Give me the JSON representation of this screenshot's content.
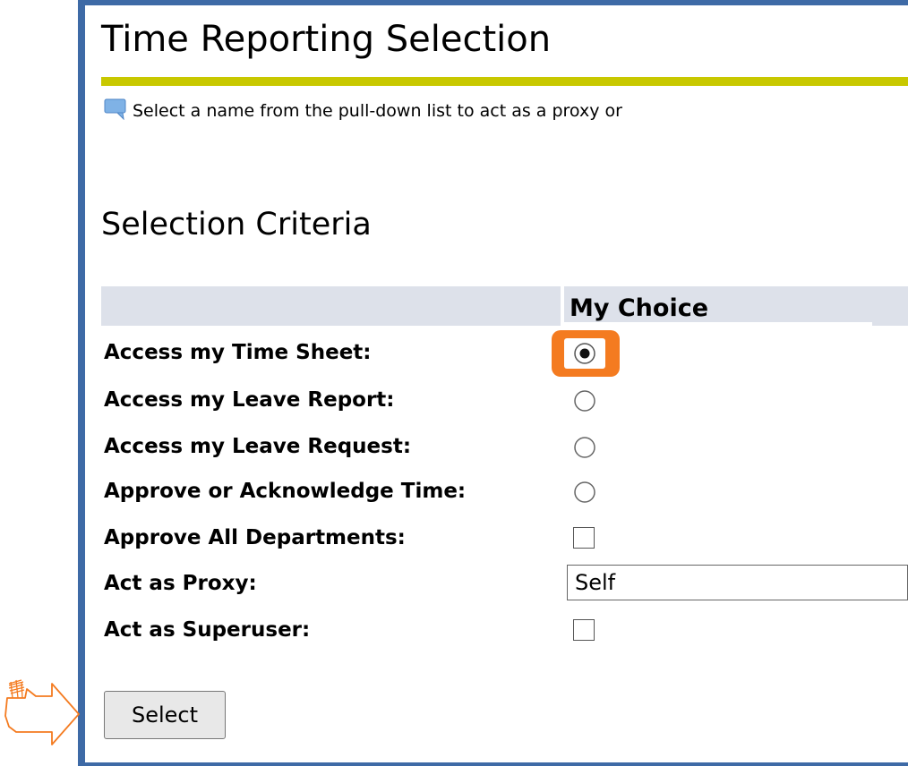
{
  "page": {
    "title": "Time Reporting Selection",
    "info_text": "Select a name from the pull-down list to act as a proxy or",
    "section_title": "Selection Criteria"
  },
  "table": {
    "column_header": "My Choice",
    "rows": [
      {
        "label": "Access my Time Sheet:",
        "control": "radio",
        "checked": true
      },
      {
        "label": "Access my Leave Report:",
        "control": "radio",
        "checked": false
      },
      {
        "label": "Access my Leave Request:",
        "control": "radio",
        "checked": false
      },
      {
        "label": "Approve or Acknowledge Time:",
        "control": "radio",
        "checked": false
      },
      {
        "label": "Approve All Departments:",
        "control": "checkbox",
        "checked": false
      },
      {
        "label": "Act as Proxy:",
        "control": "select",
        "value": "Self"
      },
      {
        "label": "Act as Superuser:",
        "control": "checkbox",
        "checked": false
      }
    ]
  },
  "actions": {
    "select_label": "Select"
  },
  "colors": {
    "frame": "#3e6aa6",
    "title_rule": "#c8c800",
    "header_bg": "#dde1ea",
    "highlight": "#f47b20",
    "pointer": "#f47b20"
  },
  "icons": {
    "info": "speech-bubble-icon",
    "pointer": "pointing-hand-icon"
  }
}
